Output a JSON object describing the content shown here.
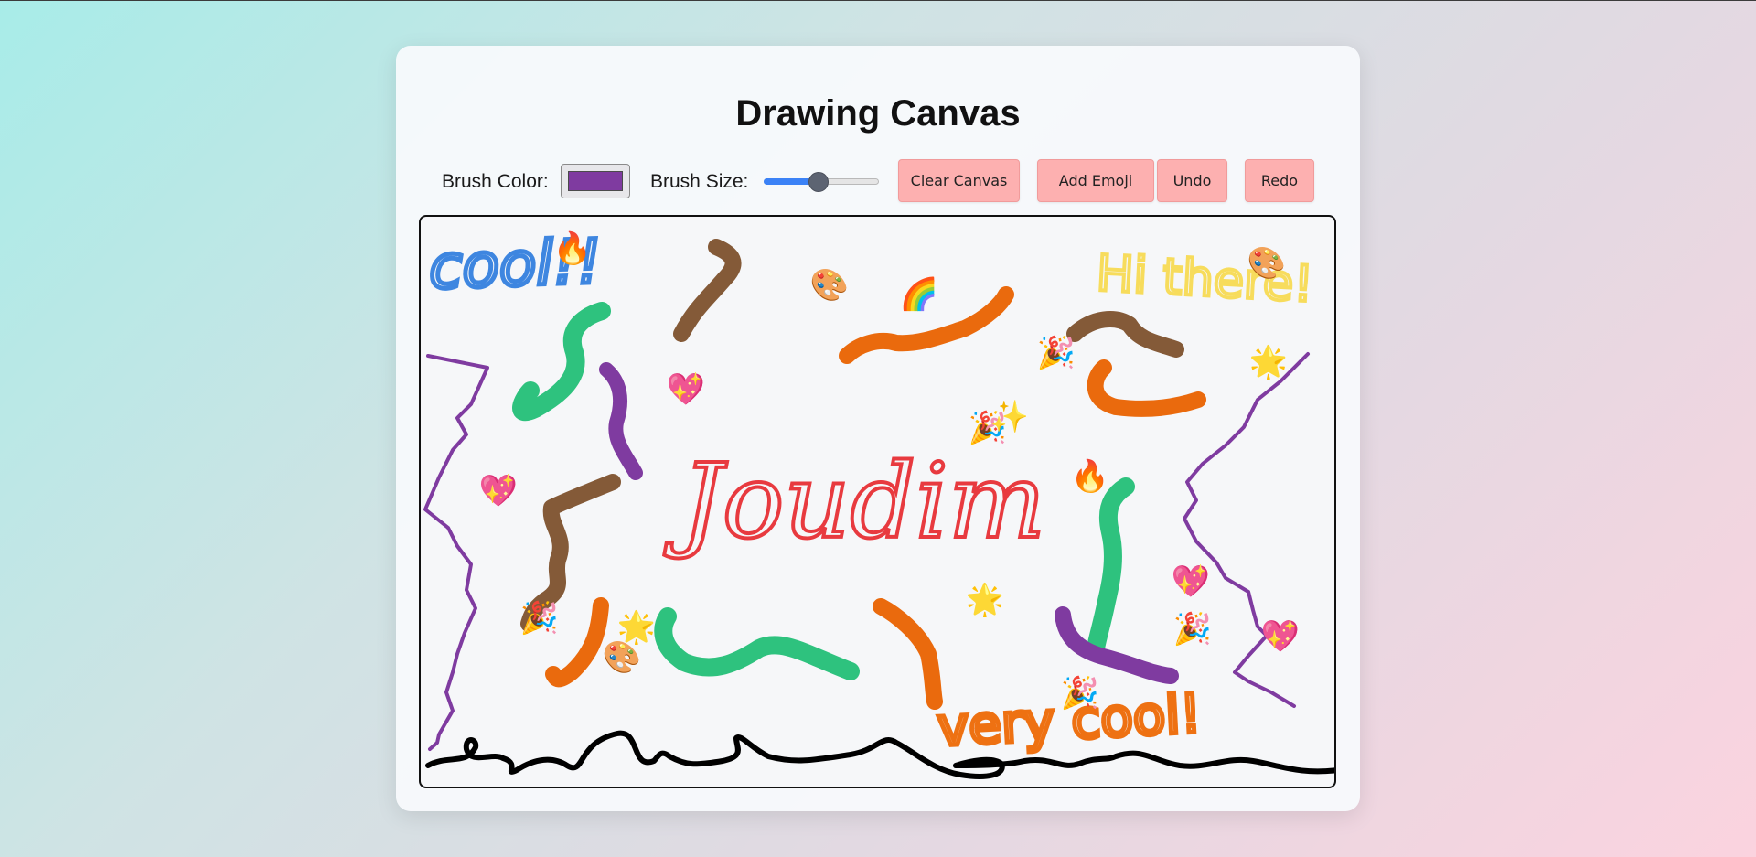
{
  "app": {
    "title": "Drawing Canvas"
  },
  "toolbar": {
    "brush_color_label": "Brush Color:",
    "brush_color": "#7f3ba0",
    "brush_size_label": "Brush Size:",
    "brush_size_fraction": 0.48,
    "clear_label": "Clear Canvas",
    "emoji_label": "Add Emoji",
    "undo_label": "Undo",
    "redo_label": "Redo"
  },
  "canvas": {
    "texts": [
      {
        "name": "text-cool",
        "text": "cool!!",
        "color": "#3e86e0"
      },
      {
        "name": "text-hi-there",
        "text": "Hi there!",
        "color": "#f7dc5c"
      },
      {
        "name": "text-joudim",
        "text": "Joudim",
        "color": "#e83a3f"
      },
      {
        "name": "text-very-cool",
        "text": "very cool!",
        "color": "#ee7112"
      }
    ],
    "colors": {
      "green": "#2ec27e",
      "purple": "#7f3ba0",
      "brown": "#845a38",
      "orange": "#ea6a0d",
      "black": "#000000"
    },
    "emojis": [
      {
        "name": "fire",
        "char": "🔥"
      },
      {
        "name": "palette",
        "char": "🎨"
      },
      {
        "name": "rainbow",
        "char": "🌈"
      },
      {
        "name": "party-popper",
        "char": "🎉"
      },
      {
        "name": "heart",
        "char": "💖"
      },
      {
        "name": "star",
        "char": "🌟"
      },
      {
        "name": "sparkles",
        "char": "✨"
      }
    ]
  }
}
